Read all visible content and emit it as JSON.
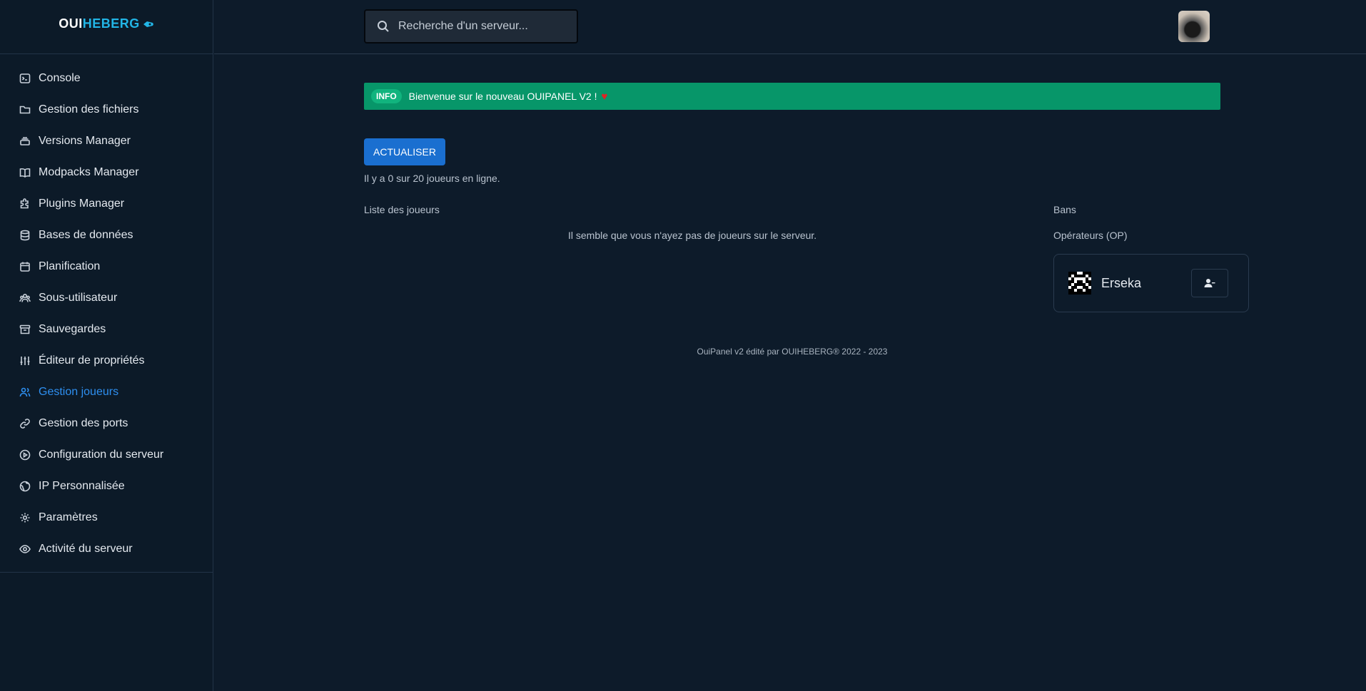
{
  "brand": {
    "part1": "OUI",
    "part2": "HEBERG"
  },
  "search": {
    "placeholder": "Recherche d'un serveur..."
  },
  "sidebar": {
    "items": [
      {
        "label": "Console",
        "icon": "terminal-icon"
      },
      {
        "label": "Gestion des fichiers",
        "icon": "folder-icon"
      },
      {
        "label": "Versions Manager",
        "icon": "layers-icon"
      },
      {
        "label": "Modpacks Manager",
        "icon": "book-icon"
      },
      {
        "label": "Plugins Manager",
        "icon": "puzzle-icon"
      },
      {
        "label": "Bases de données",
        "icon": "database-icon"
      },
      {
        "label": "Planification",
        "icon": "calendar-icon"
      },
      {
        "label": "Sous-utilisateur",
        "icon": "users-icon"
      },
      {
        "label": "Sauvegardes",
        "icon": "archive-icon"
      },
      {
        "label": "Éditeur de propriétés",
        "icon": "sliders-icon"
      },
      {
        "label": "Gestion joueurs",
        "icon": "user-group-icon",
        "active": true
      },
      {
        "label": "Gestion des ports",
        "icon": "link-icon"
      },
      {
        "label": "Configuration du serveur",
        "icon": "play-circle-icon"
      },
      {
        "label": "IP Personnalisée",
        "icon": "globe-icon"
      },
      {
        "label": "Paramètres",
        "icon": "gear-icon"
      },
      {
        "label": "Activité du serveur",
        "icon": "eye-icon"
      }
    ]
  },
  "banner": {
    "badge": "INFO",
    "text": "Bienvenue sur le nouveau OUIPANEL V2 !",
    "icon": "heart-icon"
  },
  "main": {
    "refresh_label": "ACTUALISER",
    "online_text": "Il y a 0 sur 20 joueurs en ligne.",
    "players_label": "Liste des joueurs",
    "no_players": "Il semble que vous n'ayez pas de joueurs sur le serveur.",
    "bans_label": "Bans",
    "ops_label": "Opérateurs (OP)",
    "ops": [
      {
        "name": "Erseka"
      }
    ]
  },
  "footer": {
    "text": "OuiPanel v2 édité par OUIHEBERG® 2022 - 2023"
  },
  "colors": {
    "accent": "#1a6fd0",
    "banner": "#079669",
    "active": "#2e8ff0"
  }
}
